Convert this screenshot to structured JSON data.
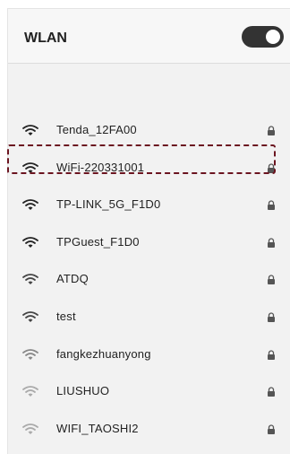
{
  "header": {
    "title": "WLAN"
  },
  "wifi_toggle": {
    "state": "on"
  },
  "networks": [
    {
      "ssid": "Tenda_12FA00",
      "signal_color": "#222222"
    },
    {
      "ssid": "WiFi-220331001",
      "signal_color": "#222222"
    },
    {
      "ssid": "TP-LINK_5G_F1D0",
      "signal_color": "#222222"
    },
    {
      "ssid": "TPGuest_F1D0",
      "signal_color": "#222222"
    },
    {
      "ssid": "ATDQ",
      "signal_color": "#444444"
    },
    {
      "ssid": "test",
      "signal_color": "#444444"
    },
    {
      "ssid": "fangkezhuanyong",
      "signal_color": "#888888"
    },
    {
      "ssid": "LIUSHUO",
      "signal_color": "#aaaaaa"
    },
    {
      "ssid": "WIFI_TAOSHI2",
      "signal_color": "#aaaaaa"
    }
  ],
  "highlight_color": "#6b1520"
}
